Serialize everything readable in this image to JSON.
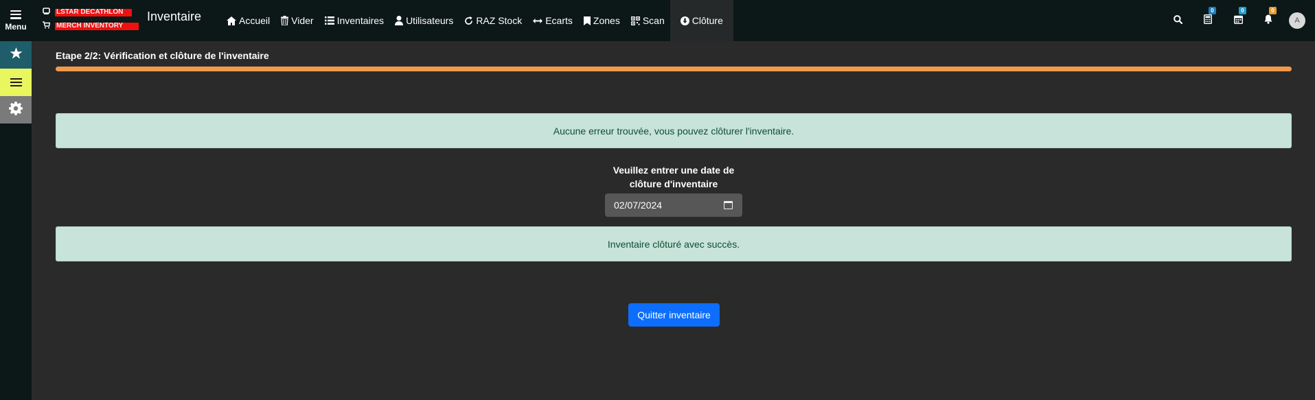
{
  "topbar": {
    "menu_label": "Menu",
    "store_line1": "LSTAR DECATHLON",
    "store_line2": "MERCH INVENTORY",
    "app_title": "Inventaire",
    "nav": [
      {
        "label": "Accueil",
        "icon": "home-icon"
      },
      {
        "label": "Vider",
        "icon": "trash-icon"
      },
      {
        "label": "Inventaires",
        "icon": "list-icon"
      },
      {
        "label": "Utilisateurs",
        "icon": "user-icon"
      },
      {
        "label": "RAZ Stock",
        "icon": "refresh-icon"
      },
      {
        "label": "Ecarts",
        "icon": "arrows-horizontal-icon"
      },
      {
        "label": "Zones",
        "icon": "bookmark-icon"
      },
      {
        "label": "Scan",
        "icon": "qrcode-icon"
      },
      {
        "label": "Clôture",
        "icon": "download-circle-icon",
        "active": true
      }
    ],
    "tools": {
      "search_icon": "search-icon",
      "calc_badge": "0",
      "calendar_badge": "0",
      "bell_badge": "0",
      "avatar_initial": "A"
    },
    "badge_colors": {
      "calc": "#1c7fbd",
      "calendar": "#1c9fd0",
      "bell": "#e69a2e"
    }
  },
  "sidebar": {
    "items": [
      {
        "icon": "star-icon",
        "color": "#1f5d6a"
      },
      {
        "icon": "list-icon",
        "color": "#e9f65e"
      },
      {
        "icon": "gear-icon",
        "color": "#7a7a7a"
      }
    ]
  },
  "main": {
    "step_title": "Etape 2/2: Vérification et clôture de l'inventaire",
    "progress_percent": 100,
    "alert_no_error": "Aucune erreur trouvée, vous pouvez clôturer l'inventaire.",
    "date_label": "Veuillez entrer une date de clôture d'inventaire",
    "date_value": "02/07/2024",
    "alert_success": "Inventaire clôturé avec succès.",
    "quit_button": "Quitter inventaire"
  },
  "colors": {
    "background": "#2b2a2a",
    "topbar": "#0c1717",
    "progress": "#f19a4c",
    "alert_bg": "#c8e3d9",
    "alert_text": "#0f4d35",
    "primary_button": "#0d6efd"
  }
}
